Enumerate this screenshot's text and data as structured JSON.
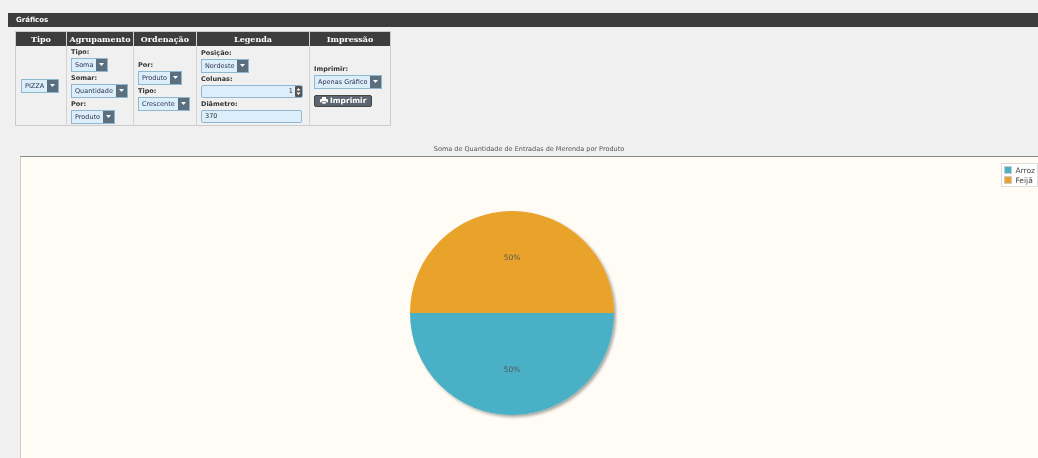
{
  "header": {
    "title": "Gráficos"
  },
  "panel": [
    {
      "heading": "Tipo",
      "controls": [
        {
          "kind": "select",
          "value": "PIZZA"
        }
      ]
    },
    {
      "heading": "Agrupamento",
      "controls": [
        {
          "kind": "label",
          "text": "Tipo:"
        },
        {
          "kind": "select",
          "value": "Soma"
        },
        {
          "kind": "label",
          "text": "Somar:"
        },
        {
          "kind": "select",
          "value": "Quantidade"
        },
        {
          "kind": "label",
          "text": "Por:"
        },
        {
          "kind": "select",
          "value": "Produto"
        }
      ]
    },
    {
      "heading": "Ordenação",
      "controls": [
        {
          "kind": "label",
          "text": "Por:"
        },
        {
          "kind": "select",
          "value": "Produto"
        },
        {
          "kind": "label",
          "text": "Tipo:"
        },
        {
          "kind": "select",
          "value": "Crescente"
        }
      ]
    },
    {
      "heading": "Legenda",
      "controls": [
        {
          "kind": "label",
          "text": "Posição:"
        },
        {
          "kind": "select",
          "value": "Nordeste"
        },
        {
          "kind": "label",
          "text": "Colunas:"
        },
        {
          "kind": "spinner",
          "value": "1"
        },
        {
          "kind": "label",
          "text": "Diâmetro:"
        },
        {
          "kind": "input",
          "value": "370"
        }
      ]
    },
    {
      "heading": "Impressão",
      "controls": [
        {
          "kind": "label",
          "text": "Imprimir:"
        },
        {
          "kind": "select",
          "value": "Apenas Gráfico"
        },
        {
          "kind": "button",
          "text": "Imprimir"
        }
      ]
    }
  ],
  "chart": {
    "chart_data": {
      "type": "pie",
      "title": "Soma de Quantidade de Entradas de Merenda por Produto",
      "categories": [
        "Arroz",
        "Feijã"
      ],
      "values": [
        50,
        50
      ],
      "legend": "top-right",
      "colors": [
        "#4ab0c6",
        "#e9a22a"
      ],
      "value_labels": [
        "50%",
        "50%"
      ]
    }
  }
}
